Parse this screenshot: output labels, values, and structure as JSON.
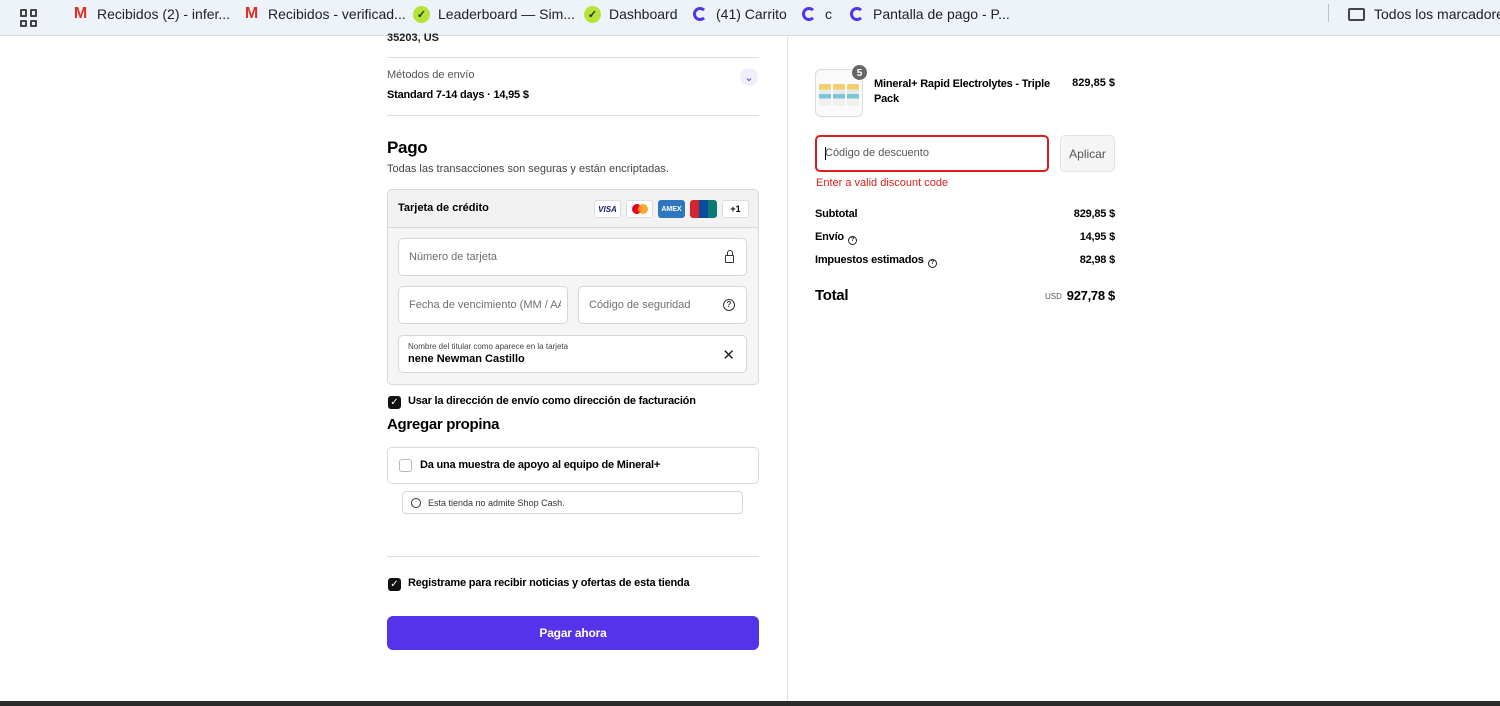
{
  "bookmarks": {
    "items": [
      {
        "label": "Recibidos (2) - infer...",
        "icon": "gmail-icon"
      },
      {
        "label": "Recibidos - verificad...",
        "icon": "gmail-icon"
      },
      {
        "label": "Leaderboard — Sim...",
        "icon": "sim-icon"
      },
      {
        "label": "Dashboard",
        "icon": "sim-icon"
      },
      {
        "label": "(41) Carrito",
        "icon": "shop-icon"
      },
      {
        "label": "c",
        "icon": "shop-icon"
      },
      {
        "label": "Pantalla de pago - P...",
        "icon": "shop-icon"
      }
    ],
    "all_bookmarks": "Todos los marcadores",
    "gmail_glyph": "M"
  },
  "address": {
    "cut_text": "35203, US"
  },
  "shipping": {
    "label": "Métodos de envío",
    "value": "Standard 7-14 days · 14,95 $"
  },
  "payment": {
    "title": "Pago",
    "subtitle": "Todas las transacciones son seguras y están encriptadas.",
    "method_label": "Tarjeta de crédito",
    "card_logos": {
      "visa": "VISA",
      "amex": "AMEX",
      "union": "UnionPay",
      "more": "+1"
    },
    "card_number_placeholder": "Número de tarjeta",
    "expiry_placeholder": "Fecha de vencimiento (MM / AA)",
    "security_placeholder": "Código de seguridad",
    "holder_label": "Nombre del titular como aparece en la tarjeta",
    "holder_value": "nene Newman Castillo",
    "billing_same_label": "Usar la dirección de envío como dirección de facturación"
  },
  "tip": {
    "title": "Agregar propina",
    "option_label": "Da una muestra de apoyo al equipo de Mineral+",
    "notice": "Esta tienda no admite Shop Cash."
  },
  "newsletter_label": "Registrame para recibir noticias y ofertas de esta tienda",
  "pay_button": "Pagar ahora",
  "order": {
    "product_name": "Mineral+ Rapid Electrolytes - Triple Pack",
    "product_price": "829,85 $",
    "quantity": "5",
    "discount_placeholder": "Código de descuento",
    "apply_label": "Aplicar",
    "error": "Enter a valid discount code",
    "subtotal_label": "Subtotal",
    "subtotal_value": "829,85 $",
    "shipping_label": "Envío",
    "shipping_value": "14,95 $",
    "tax_label": "Impuestos estimados",
    "tax_value": "82,98 $",
    "total_label": "Total",
    "currency": "USD",
    "total_value": "927,78 $"
  },
  "colors": {
    "accent": "#5433eb",
    "error": "#dd1d1d"
  }
}
